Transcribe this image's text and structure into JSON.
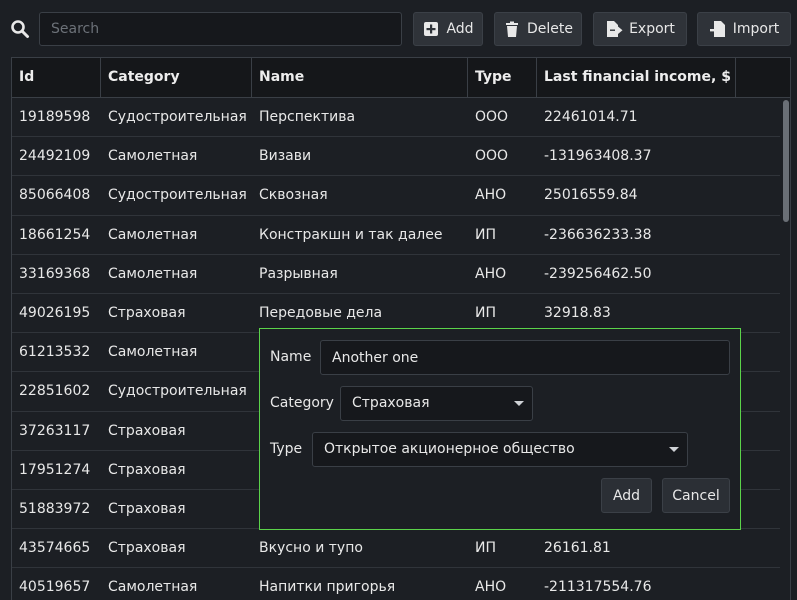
{
  "toolbar": {
    "search_placeholder": "Search",
    "search_value": "",
    "add_label": "Add",
    "delete_label": "Delete",
    "export_label": "Export",
    "import_label": "Import"
  },
  "table": {
    "columns": [
      "Id",
      "Category",
      "Name",
      "Type",
      "Last financial income, $"
    ],
    "rows": [
      {
        "id": "19189598",
        "category": "Судостроительная",
        "name": "Перспектива",
        "type": "ООО",
        "income": "22461014.71"
      },
      {
        "id": "24492109",
        "category": "Самолетная",
        "name": "Визави",
        "type": "ООО",
        "income": "-131963408.37"
      },
      {
        "id": "85066408",
        "category": "Судостроительная",
        "name": "Сквозная",
        "type": "АНО",
        "income": "25016559.84"
      },
      {
        "id": "18661254",
        "category": "Самолетная",
        "name": "Констракшн и так далее",
        "type": "ИП",
        "income": "-236636233.38"
      },
      {
        "id": "33169368",
        "category": "Самолетная",
        "name": "Разрывная",
        "type": "АНО",
        "income": "-239256462.50"
      },
      {
        "id": "49026195",
        "category": "Страховая",
        "name": "Передовые дела",
        "type": "ИП",
        "income": "32918.83"
      },
      {
        "id": "61213532",
        "category": "Самолетная",
        "name": "",
        "type": "",
        "income": ""
      },
      {
        "id": "22851602",
        "category": "Судостроительная",
        "name": "",
        "type": "",
        "income": ""
      },
      {
        "id": "37263117",
        "category": "Страховая",
        "name": "",
        "type": "",
        "income": ""
      },
      {
        "id": "17951274",
        "category": "Страховая",
        "name": "",
        "type": "",
        "income": ""
      },
      {
        "id": "51883972",
        "category": "Страховая",
        "name": "",
        "type": "",
        "income": ""
      },
      {
        "id": "43574665",
        "category": "Страховая",
        "name": "Вкусно и тупо",
        "type": "ИП",
        "income": "26161.81"
      },
      {
        "id": "40519657",
        "category": "Самолетная",
        "name": "Напитки пригорья",
        "type": "АНО",
        "income": "-211317554.76"
      }
    ]
  },
  "dialog": {
    "name_label": "Name",
    "name_value": "Another one",
    "category_label": "Category",
    "category_value": "Страховая",
    "type_label": "Type",
    "type_value": "Открытое акционерное общество",
    "add_label": "Add",
    "cancel_label": "Cancel",
    "border_color": "#5bd34a"
  },
  "icons": {
    "search": "search-icon",
    "add": "plus-square-icon",
    "delete": "trash-icon",
    "export": "file-export-icon",
    "import": "file-import-icon"
  }
}
